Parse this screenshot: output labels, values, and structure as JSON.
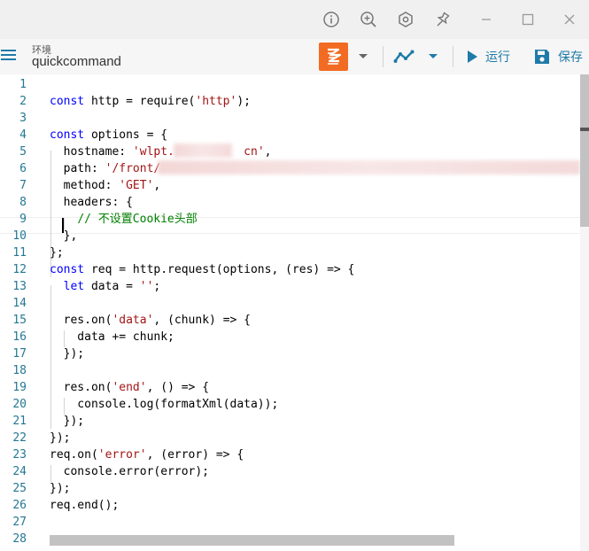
{
  "titlebar": {
    "icons": [
      "info-icon",
      "zoom-in-icon",
      "plugin-icon",
      "pin-icon",
      "minimize-icon",
      "maximize-icon",
      "close-icon"
    ]
  },
  "toolbar": {
    "env_label": "环境",
    "env_name": "quickcommand",
    "language_icon": "javascript-icon",
    "debug_icon": "debug-icon",
    "run_label": "运行",
    "save_label": "保存",
    "colors": {
      "accent": "#1e7aa8",
      "lang_bg": "#f26b22"
    }
  },
  "editor": {
    "line_numbers": [
      "1",
      "2",
      "3",
      "4",
      "5",
      "6",
      "7",
      "8",
      "9",
      "10",
      "11",
      "12",
      "13",
      "14",
      "15",
      "16",
      "17",
      "18",
      "19",
      "20",
      "21",
      "22",
      "23",
      "24",
      "25",
      "26",
      "27",
      "28"
    ],
    "lines": [
      [],
      [
        {
          "t": "const",
          "c": "kw"
        },
        {
          "t": " http = require("
        },
        {
          "t": "'http'",
          "c": "str"
        },
        {
          "t": ");"
        }
      ],
      [],
      [
        {
          "t": "const",
          "c": "kw"
        },
        {
          "t": " options = {"
        }
      ],
      [
        {
          "t": "  hostname: "
        },
        {
          "t": "'wlpt.",
          "c": "str"
        },
        {
          "t": "          "
        },
        {
          "t": "cn'",
          "c": "str"
        },
        {
          "t": ","
        }
      ],
      [
        {
          "t": "  path: "
        },
        {
          "t": "'/front/",
          "c": "str"
        }
      ],
      [
        {
          "t": "  method: "
        },
        {
          "t": "'GET'",
          "c": "str"
        },
        {
          "t": ","
        }
      ],
      [
        {
          "t": "  headers: {"
        }
      ],
      [
        {
          "t": "    "
        },
        {
          "t": "// 不设置Cookie头部",
          "c": "cm"
        }
      ],
      [
        {
          "t": "  },"
        }
      ],
      [
        {
          "t": "};"
        }
      ],
      [
        {
          "t": "const",
          "c": "kw"
        },
        {
          "t": " req = http.request(options, (res) => {"
        }
      ],
      [
        {
          "t": "  "
        },
        {
          "t": "let",
          "c": "kw"
        },
        {
          "t": " data = "
        },
        {
          "t": "''",
          "c": "str"
        },
        {
          "t": ";"
        }
      ],
      [],
      [
        {
          "t": "  res.on("
        },
        {
          "t": "'data'",
          "c": "str"
        },
        {
          "t": ", (chunk) => {"
        }
      ],
      [
        {
          "t": "    data += chunk;"
        }
      ],
      [
        {
          "t": "  });"
        }
      ],
      [],
      [
        {
          "t": "  res.on("
        },
        {
          "t": "'end'",
          "c": "str"
        },
        {
          "t": ", () => {"
        }
      ],
      [
        {
          "t": "    console.log(formatXml(data));"
        }
      ],
      [
        {
          "t": "  });"
        }
      ],
      [
        {
          "t": "});"
        }
      ],
      [
        {
          "t": "req.on("
        },
        {
          "t": "'error'",
          "c": "str"
        },
        {
          "t": ", (error) => {"
        }
      ],
      [
        {
          "t": "  console.error(error);"
        }
      ],
      [
        {
          "t": "});"
        }
      ],
      [
        {
          "t": "req.end();"
        }
      ],
      [],
      []
    ]
  }
}
